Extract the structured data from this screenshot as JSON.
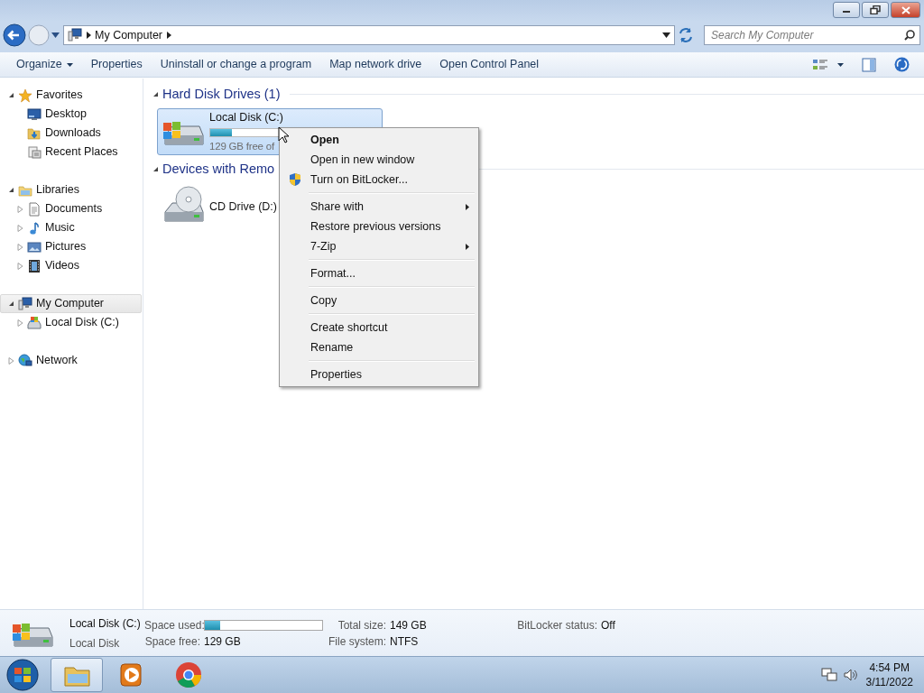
{
  "address_bar": {
    "path": "My Computer"
  },
  "search": {
    "placeholder": "Search My Computer"
  },
  "toolbar": [
    {
      "label": "Organize",
      "dropdown": true
    },
    {
      "label": "Properties",
      "dropdown": false
    },
    {
      "label": "Uninstall or change a program",
      "dropdown": false
    },
    {
      "label": "Map network drive",
      "dropdown": false
    },
    {
      "label": "Open Control Panel",
      "dropdown": false
    }
  ],
  "nav_pane": [
    {
      "label": "Favorites",
      "expanded": true,
      "selected": false,
      "children": [
        {
          "label": "Desktop",
          "selected": false
        },
        {
          "label": "Downloads",
          "selected": false
        },
        {
          "label": "Recent Places",
          "selected": false
        }
      ]
    },
    {
      "label": "Libraries",
      "expanded": true,
      "selected": false,
      "children": [
        {
          "label": "Documents",
          "expanded": false,
          "selected": false
        },
        {
          "label": "Music",
          "expanded": false,
          "selected": false
        },
        {
          "label": "Pictures",
          "expanded": false,
          "selected": false
        },
        {
          "label": "Videos",
          "expanded": false,
          "selected": false
        }
      ]
    },
    {
      "label": "My Computer",
      "expanded": true,
      "selected": true,
      "children": [
        {
          "label": "Local Disk (C:)",
          "expanded": false,
          "selected": false
        }
      ]
    },
    {
      "label": "Network",
      "expanded": false,
      "selected": false
    }
  ],
  "groups": [
    {
      "title": "Hard Disk Drives (1)",
      "expanded": true,
      "items": [
        {
          "kind": "disk",
          "name": "Local Disk (C:)",
          "level": 0.13,
          "free": "129 GB free of",
          "selected": true
        }
      ]
    },
    {
      "title": "Devices with Remo",
      "expanded": true,
      "items": [
        {
          "kind": "cd",
          "name": "CD Drive (D:)",
          "selected": false
        }
      ]
    }
  ],
  "context_menu": [
    [
      {
        "label": "Open",
        "default": true,
        "elevated": false,
        "submenu": false
      },
      {
        "label": "Open in new window",
        "default": false,
        "elevated": false,
        "submenu": false
      },
      {
        "label": "Turn on BitLocker...",
        "default": false,
        "elevated": true,
        "submenu": false
      }
    ],
    [
      {
        "label": "Share with",
        "default": false,
        "elevated": false,
        "submenu": true
      },
      {
        "label": "Restore previous versions",
        "default": false,
        "elevated": false,
        "submenu": false
      },
      {
        "label": "7-Zip",
        "default": false,
        "elevated": false,
        "submenu": true
      }
    ],
    [
      {
        "label": "Format...",
        "default": false,
        "elevated": false,
        "submenu": false
      }
    ],
    [
      {
        "label": "Copy",
        "default": false,
        "elevated": false,
        "submenu": false
      }
    ],
    [
      {
        "label": "Create shortcut",
        "default": false,
        "elevated": false,
        "submenu": false
      },
      {
        "label": "Rename",
        "default": false,
        "elevated": false,
        "submenu": false
      }
    ],
    [
      {
        "label": "Properties",
        "default": false,
        "elevated": false,
        "submenu": false
      }
    ]
  ],
  "details": {
    "name": "Local Disk (C:)",
    "type": "Local Disk",
    "properties": [
      {
        "label": "Space used:",
        "kind": "bar",
        "level": 0.13
      },
      {
        "label": "Total size:",
        "kind": "text",
        "value": "149 GB"
      },
      {
        "label": "BitLocker status:",
        "kind": "text",
        "value": "Off"
      },
      {
        "label": "Space free:",
        "kind": "text",
        "value": "129 GB"
      },
      {
        "label": "File system:",
        "kind": "text",
        "value": "NTFS"
      }
    ]
  },
  "taskbar": {
    "apps": [
      {
        "selected": true
      },
      {
        "selected": false
      },
      {
        "selected": false
      }
    ],
    "time": "4:54 PM",
    "date": "3/11/2022"
  }
}
